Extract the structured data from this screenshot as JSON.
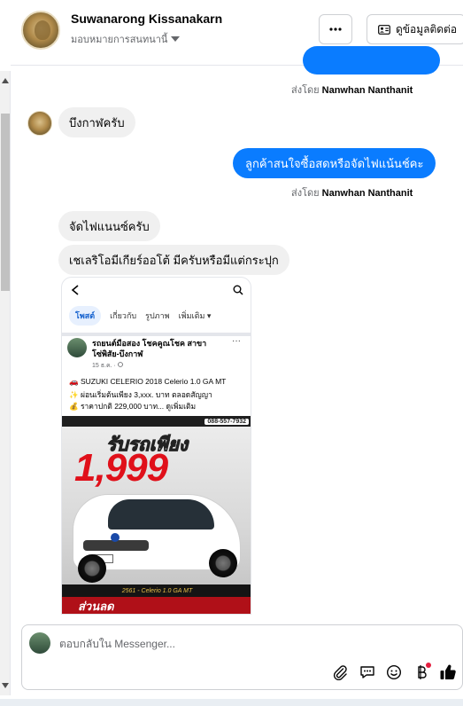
{
  "header": {
    "name": "Suwanarong Kissanakarn",
    "assigned_label": "มอบหมายการสนทนานี้",
    "more_label": "···",
    "contact_label": "ดูข้อมูลติดต่อ"
  },
  "messages": {
    "m0_sent_by_prefix": "ส่งโดย",
    "m0_sent_by_name": "Nanwhan Nanthanit",
    "m1_text": "บึงกาฬครับ",
    "m2_text": "ลูกค้าสนใจซื้อสดหรือจัดไฟแน้นช์คะ",
    "m2_sent_by_prefix": "ส่งโดย",
    "m2_sent_by_name": "Nanwhan Nanthanit",
    "m3_text": "จัดไฟแนนซ์ครับ",
    "m4_text": "เชเลริโอมีเกียร์ออโต้ มีครับหรือมีแต่กระปุก"
  },
  "shared_screenshot": {
    "tabs": [
      "โพสต์",
      "เกี่ยวกับ",
      "รูปภาพ",
      "เพิ่มเติม"
    ],
    "post_author": "รถยนต์มือสอง โชคคูณโชค สาขาโซ่พิสัย-บึงกาฬ",
    "post_time": "15 ธ.ค. · ",
    "line1": "SUZUKI CELERIO 2018 Celerio 1.0 GA MT",
    "line2": "ผ่อนเริ่มต้นเพียง 3,xxx. บาท ตลอดสัญญา",
    "line3": "ราคาปกติ 229,000 บาท... ดูเพิ่มเติม",
    "phone": "088-557-7932",
    "headline": "รับรถเพียง",
    "price": "1,999",
    "model_caption": "2561 - Celerio 1.0 GA MT",
    "bottom_text": "ส่วนลด"
  },
  "composer": {
    "placeholder": "ตอบกลับใน Messenger..."
  },
  "colors": {
    "messenger_blue": "#0a7cff",
    "incoming_gray": "#f0f0f0",
    "like_icon": "#050505"
  },
  "icons": [
    "more-icon",
    "contact-card-icon",
    "chevron-down-icon",
    "paperclip-icon",
    "saved-reply-icon",
    "emoji-icon",
    "baht-icon",
    "thumbs-up-icon"
  ]
}
